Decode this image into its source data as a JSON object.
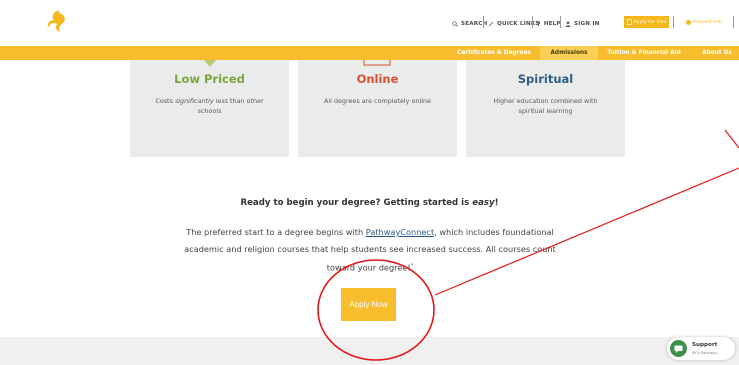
{
  "header": {
    "utility_links": {
      "search": "SEARCH",
      "quick_links": "QUICK LINKS",
      "help": "HELP",
      "sign_in": "SIGN IN"
    },
    "apply_for_free": "Apply For Free",
    "request_info": "Request Info",
    "icons": [
      "logo-flame-icon",
      "search-icon",
      "link-icon",
      "question-icon",
      "user-icon",
      "document-icon"
    ]
  },
  "nav": {
    "items": [
      {
        "label": "Certificates & Degrees",
        "active": false
      },
      {
        "label": "Admissions",
        "active": true
      },
      {
        "label": "Tuition & Financial Aid",
        "active": false
      },
      {
        "label": "About Us",
        "active": false
      }
    ]
  },
  "cards": [
    {
      "title": "Low Priced",
      "title_color": "#7aa63a",
      "text_before": "Costs ",
      "text_emph": "significantly less",
      "text_after": " than other schools"
    },
    {
      "title": "Online",
      "title_color": "#d9512c",
      "text": "All degrees are completely online"
    },
    {
      "title": "Spiritual",
      "title_color": "#2f5d86",
      "text": "Higher education combined with spiritual learning"
    }
  ],
  "main": {
    "headline_prefix": "Ready to begin your degree? Getting started is ",
    "headline_emph": "easy",
    "headline_suffix": "!",
    "body_before_link": "The preferred start to a degree begins with ",
    "body_link": "PathwayConnect",
    "body_after_link": ", which includes foundational academic and religion courses that help students see increased success. All courses count toward your degree!",
    "footnote_mark": "*",
    "apply_now": "Apply Now"
  },
  "support_widget": {
    "title": "Support",
    "subtitle": "BYU-Pathway..."
  },
  "colors": {
    "brand_yellow": "#f7bd2d",
    "annotation_red": "#e01818"
  }
}
